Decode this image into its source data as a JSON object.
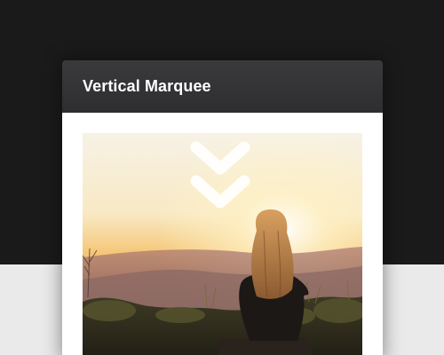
{
  "header": {
    "title": "Vertical Marquee"
  },
  "colors": {
    "page_dark": "#1b1a1b",
    "page_light": "#eaeaea",
    "header_bg": "#333234",
    "card_bg": "#ffffff",
    "chevron": "#ffffff"
  },
  "icons": {
    "scroll": "double-chevron-down-icon"
  }
}
